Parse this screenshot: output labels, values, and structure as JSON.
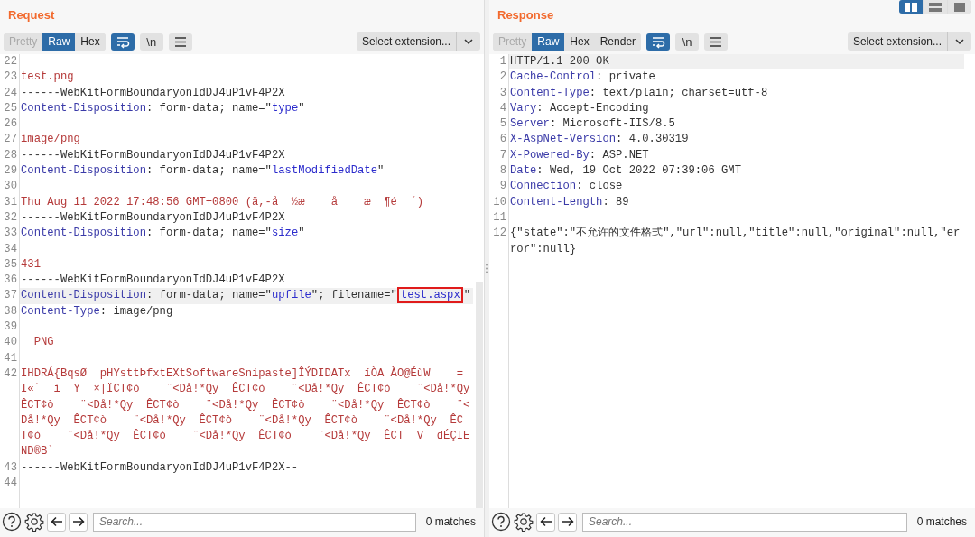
{
  "layout_buttons": [
    {
      "kind": "columns",
      "selected": true
    },
    {
      "kind": "rows",
      "selected": false
    },
    {
      "kind": "single",
      "selected": false
    }
  ],
  "panes": [
    {
      "title": "Request",
      "view_tabs": [
        {
          "label": "Pretty",
          "selected": false,
          "disabled": true
        },
        {
          "label": "Raw",
          "selected": true,
          "disabled": false
        },
        {
          "label": "Hex",
          "selected": false,
          "disabled": false
        }
      ],
      "tools": [
        {
          "kind": "wrap",
          "on": true
        },
        {
          "kind": "newline",
          "label": "\\n",
          "on": false
        },
        {
          "kind": "menu",
          "on": false
        }
      ],
      "extension_select": "Select extension...",
      "lines": [
        {
          "n": "22",
          "highlighted": false
        },
        {
          "n": "23",
          "highlighted": false,
          "segments": [
            {
              "kind": "body",
              "text": "test.png"
            }
          ]
        },
        {
          "n": "24",
          "highlighted": false,
          "segments": [
            {
              "kind": "plain",
              "text": "------WebKitFormBoundaryonIdDJ4uP1vF4P2X"
            }
          ]
        },
        {
          "n": "25",
          "highlighted": false,
          "segments": [
            {
              "kind": "key",
              "text": "Content-Disposition"
            },
            {
              "kind": "plain",
              "text": ": form-data; name=\""
            },
            {
              "kind": "string",
              "text": "type"
            },
            {
              "kind": "plain",
              "text": "\""
            }
          ]
        },
        {
          "n": "26",
          "highlighted": false
        },
        {
          "n": "27",
          "highlighted": false,
          "segments": [
            {
              "kind": "body",
              "text": "image/png"
            }
          ]
        },
        {
          "n": "28",
          "highlighted": false,
          "segments": [
            {
              "kind": "plain",
              "text": "------WebKitFormBoundaryonIdDJ4uP1vF4P2X"
            }
          ]
        },
        {
          "n": "29",
          "highlighted": false,
          "segments": [
            {
              "kind": "key",
              "text": "Content-Disposition"
            },
            {
              "kind": "plain",
              "text": ": form-data; name=\""
            },
            {
              "kind": "string",
              "text": "lastModifiedDate"
            },
            {
              "kind": "plain",
              "text": "\""
            }
          ]
        },
        {
          "n": "30",
          "highlighted": false
        },
        {
          "n": "31",
          "highlighted": false,
          "segments": [
            {
              "kind": "body",
              "text": "Thu Aug 11 2022 17:48:56 GMT+0800 (ä,-å  ½æ    å    æ  ¶é  ´)"
            }
          ]
        },
        {
          "n": "32",
          "highlighted": false,
          "segments": [
            {
              "kind": "plain",
              "text": "------WebKitFormBoundaryonIdDJ4uP1vF4P2X"
            }
          ]
        },
        {
          "n": "33",
          "highlighted": false,
          "segments": [
            {
              "kind": "key",
              "text": "Content-Disposition"
            },
            {
              "kind": "plain",
              "text": ": form-data; name=\""
            },
            {
              "kind": "string",
              "text": "size"
            },
            {
              "kind": "plain",
              "text": "\""
            }
          ]
        },
        {
          "n": "34",
          "highlighted": false
        },
        {
          "n": "35",
          "highlighted": false,
          "segments": [
            {
              "kind": "body",
              "text": "431"
            }
          ]
        },
        {
          "n": "36",
          "highlighted": false,
          "segments": [
            {
              "kind": "plain",
              "text": "------WebKitFormBoundaryonIdDJ4uP1vF4P2X"
            }
          ]
        },
        {
          "n": "37",
          "highlighted": true,
          "segments": [
            {
              "kind": "key",
              "text": "Content-Disposition"
            },
            {
              "kind": "plain",
              "text": ": form-data; name=\""
            },
            {
              "kind": "string",
              "text": "upfile"
            },
            {
              "kind": "plain",
              "text": "\"; filename=\""
            },
            {
              "kind": "string",
              "text": "test.aspx",
              "boxed": true
            },
            {
              "kind": "plain",
              "text": "\""
            }
          ]
        },
        {
          "n": "38",
          "highlighted": false,
          "segments": [
            {
              "kind": "key",
              "text": "Content-Type"
            },
            {
              "kind": "plain",
              "text": ": image/png"
            }
          ]
        },
        {
          "n": "39",
          "highlighted": false
        },
        {
          "n": "40",
          "highlighted": false,
          "segments": [
            {
              "kind": "body",
              "text": "  PNG"
            }
          ]
        },
        {
          "n": "41",
          "highlighted": false
        },
        {
          "n": "42",
          "highlighted": false,
          "segments": [
            {
              "kind": "body",
              "text": "IHDRÁ{BqsØ  pHYsttÞfxtEXtSoftwareSnipaste]ÎÝDIDATx  íÒA ÀO@ÉùW    =I«`  í  Y  ×|ÏCT¢ò    ¨<Då!*Qy  ÊCT¢ò    ¨<Då!*Qy  ÊCT¢ò    ¨<Då!*Qy  ÊCT¢ò    ¨<Då!*Qy  ÊCT¢ò    ¨<Då!*Qy  ÊCT¢ò    ¨<Då!*Qy  ÊCT¢ò    ¨<Då!*Qy  ÊCT¢ò    ¨<Då!*Qy  ÊCT¢ò    ¨<Då!*Qy  ÊCT¢ò    ¨<Då!*Qy  ÊCT¢ò    ¨<Då!*Qy  ÊCT¢ò    ¨<Då!*Qy  ÊCT¢ò    ¨<Då!*Qy  ÊCT  V  dÉÇIEND®B`"
            }
          ]
        },
        {
          "n": "43",
          "highlighted": false,
          "segments": [
            {
              "kind": "plain",
              "text": "------WebKitFormBoundaryonIdDJ4uP1vF4P2X--"
            }
          ]
        },
        {
          "n": "44",
          "highlighted": false
        }
      ],
      "search": {
        "placeholder": "Search..."
      },
      "matches": "0 matches"
    },
    {
      "title": "Response",
      "view_tabs": [
        {
          "label": "Pretty",
          "selected": false,
          "disabled": true
        },
        {
          "label": "Raw",
          "selected": true,
          "disabled": false
        },
        {
          "label": "Hex",
          "selected": false,
          "disabled": false
        },
        {
          "label": "Render",
          "selected": false,
          "disabled": false
        }
      ],
      "tools": [
        {
          "kind": "wrap",
          "on": true
        },
        {
          "kind": "newline",
          "label": "\\n",
          "on": false
        },
        {
          "kind": "menu",
          "on": false
        }
      ],
      "extension_select": "Select extension...",
      "lines": [
        {
          "n": "1",
          "highlighted": true,
          "segments": [
            {
              "kind": "plain",
              "text": "HTTP/1.1 200 OK"
            }
          ]
        },
        {
          "n": "2",
          "highlighted": false,
          "segments": [
            {
              "kind": "key",
              "text": "Cache-Control"
            },
            {
              "kind": "plain",
              "text": ": private"
            }
          ]
        },
        {
          "n": "3",
          "highlighted": false,
          "segments": [
            {
              "kind": "key",
              "text": "Content-Type"
            },
            {
              "kind": "plain",
              "text": ": text/plain; charset=utf-8"
            }
          ]
        },
        {
          "n": "4",
          "highlighted": false,
          "segments": [
            {
              "kind": "key",
              "text": "Vary"
            },
            {
              "kind": "plain",
              "text": ": Accept-Encoding"
            }
          ]
        },
        {
          "n": "5",
          "highlighted": false,
          "segments": [
            {
              "kind": "key",
              "text": "Server"
            },
            {
              "kind": "plain",
              "text": ": Microsoft-IIS/8.5"
            }
          ]
        },
        {
          "n": "6",
          "highlighted": false,
          "segments": [
            {
              "kind": "key",
              "text": "X-AspNet-Version"
            },
            {
              "kind": "plain",
              "text": ": 4.0.30319"
            }
          ]
        },
        {
          "n": "7",
          "highlighted": false,
          "segments": [
            {
              "kind": "key",
              "text": "X-Powered-By"
            },
            {
              "kind": "plain",
              "text": ": ASP.NET"
            }
          ]
        },
        {
          "n": "8",
          "highlighted": false,
          "segments": [
            {
              "kind": "key",
              "text": "Date"
            },
            {
              "kind": "plain",
              "text": ": Wed, 19 Oct 2022 07:39:06 GMT"
            }
          ]
        },
        {
          "n": "9",
          "highlighted": false,
          "segments": [
            {
              "kind": "key",
              "text": "Connection"
            },
            {
              "kind": "plain",
              "text": ": close"
            }
          ]
        },
        {
          "n": "10",
          "highlighted": false,
          "segments": [
            {
              "kind": "key",
              "text": "Content-Length"
            },
            {
              "kind": "plain",
              "text": ": 89"
            }
          ]
        },
        {
          "n": "11",
          "highlighted": false
        },
        {
          "n": "12",
          "highlighted": false,
          "segments": [
            {
              "kind": "plain",
              "text": "{\"state\":\"不允许的文件格式\",\"url\":null,\"title\":null,\"original\":null,\"error\":null}"
            }
          ]
        }
      ],
      "search": {
        "placeholder": "Search..."
      },
      "matches": "0 matches"
    }
  ]
}
